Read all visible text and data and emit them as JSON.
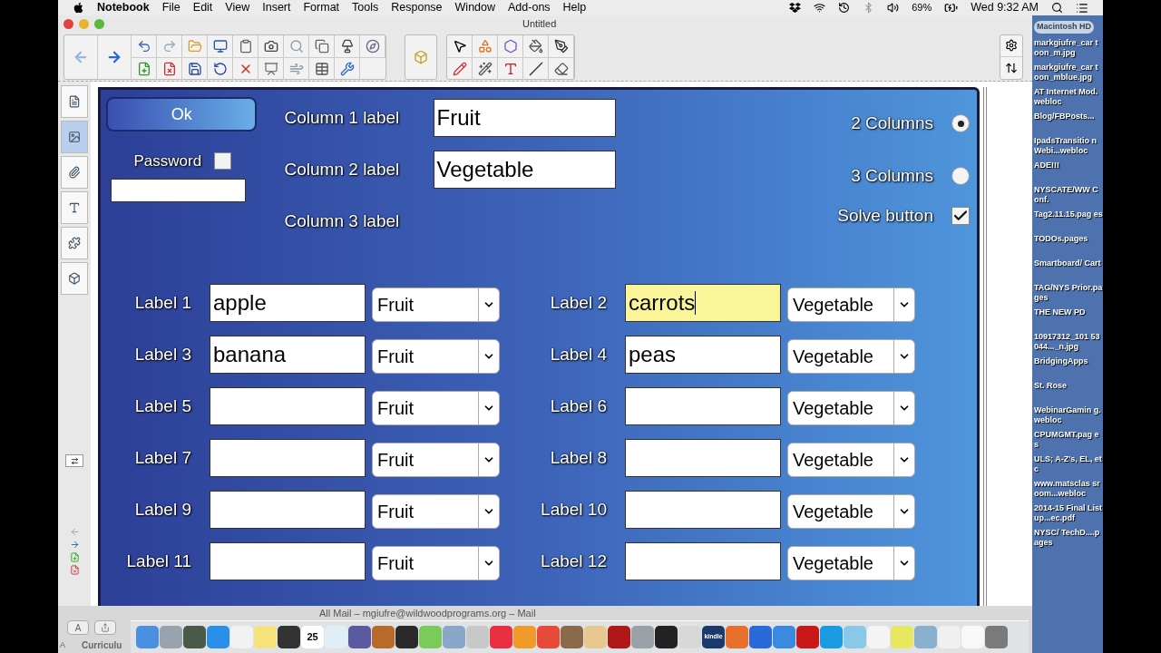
{
  "menu_bar": {
    "app": "Notebook",
    "items": [
      "File",
      "Edit",
      "View",
      "Insert",
      "Format",
      "Tools",
      "Response",
      "Window",
      "Add-ons",
      "Help"
    ],
    "battery": "69%",
    "clock": "Wed 9:32 AM"
  },
  "window": {
    "title": "Untitled"
  },
  "form": {
    "ok_button": "Ok",
    "password": {
      "label": "Password",
      "checked": false
    },
    "column_labels": [
      {
        "label": "Column 1 label",
        "value": "Fruit"
      },
      {
        "label": "Column 2 label",
        "value": "Vegetable"
      },
      {
        "label": "Column 3 label"
      }
    ],
    "column_options": [
      {
        "label": "2 Columns",
        "selected": true
      },
      {
        "label": "3 Columns",
        "selected": false
      }
    ],
    "solve": {
      "label": "Solve button",
      "checked": true
    }
  },
  "rows": [
    {
      "label": "Label 1",
      "value": "apple",
      "category": "Fruit",
      "highlighted": false
    },
    {
      "label": "Label 2",
      "value": "carrots",
      "category": "Vegetable",
      "highlighted": true
    },
    {
      "label": "Label 3",
      "value": "banana",
      "category": "Fruit",
      "highlighted": false
    },
    {
      "label": "Label 4",
      "value": "peas",
      "category": "Vegetable",
      "highlighted": false
    },
    {
      "label": "Label 5",
      "category": "Fruit",
      "highlighted": false
    },
    {
      "label": "Label 6",
      "category": "Vegetable",
      "highlighted": false
    },
    {
      "label": "Label 7",
      "category": "Fruit",
      "highlighted": false
    },
    {
      "label": "Label 8",
      "category": "Vegetable",
      "highlighted": false
    },
    {
      "label": "Label 9",
      "category": "Fruit",
      "highlighted": false
    },
    {
      "label": "Label 10",
      "category": "Vegetable",
      "highlighted": false
    },
    {
      "label": "Label 11",
      "category": "Fruit",
      "highlighted": false
    },
    {
      "label": "Label 12",
      "category": "Vegetable",
      "highlighted": false
    }
  ],
  "desktop": {
    "drive": "Macintosh HD",
    "items": [
      "markgiufre_car toon_m.jpg",
      "markgiufre_car toon_mblue.jpg",
      "AT Internet Mod.webloc",
      "Blog/FBPosts...",
      "IpadsTransitio nWebi...webloc",
      "ADE!!!",
      "NYSCATE/WW Conf.",
      "Tag2.11.15.pag es",
      "TODOs.pages",
      "Smartboard/ Cart",
      "TAG/NYS Prior.pages",
      "THE NEW PD",
      "10917312_101 53044..._n.jpg",
      "BridgingApps",
      "St. Rose",
      "WebinarGamin g.webloc",
      "CPUMGMT.pag es",
      "ULS; A-Z's, EL, etc",
      "www.matsclas sroom...webloc",
      "2014-15 Final Listup...ec.pdf",
      "NYSC/ TechD....pages"
    ]
  },
  "mail_window": {
    "title": "All Mail – mgiufre@wildwoodprograms.org – Mail",
    "font_button": "A",
    "format_menu": "A",
    "mailbox": "Curriculu"
  },
  "dock": [
    {
      "color": "#4a8fe0"
    },
    {
      "color": "#9aa3ad"
    },
    {
      "color": "#4a5a48"
    },
    {
      "color": "#2a8fe8"
    },
    {
      "color": "#f2f2f2"
    },
    {
      "color": "#f5e27a"
    },
    {
      "color": "#333333"
    },
    {
      "color": "#ffffff",
      "text": "25"
    },
    {
      "color": "#e0eef8"
    },
    {
      "color": "#5a5aa0"
    },
    {
      "color": "#b86a2a"
    },
    {
      "color": "#2a2a2a"
    },
    {
      "color": "#7acb5a"
    },
    {
      "color": "#8aa6c8"
    },
    {
      "color": "#c8c8c8"
    },
    {
      "color": "#e83040"
    },
    {
      "color": "#f09a2a"
    },
    {
      "color": "#e84a3a"
    },
    {
      "color": "#8a6a4a"
    },
    {
      "color": "#e8c890"
    },
    {
      "color": "#b01818"
    },
    {
      "color": "#9aa0a8"
    },
    {
      "color": "#222222"
    },
    {
      "color": "#d8d8d8"
    },
    {
      "color": "#1a3a6a",
      "text": "kindle"
    },
    {
      "color": "#e8702a"
    },
    {
      "color": "#2a6ad8"
    },
    {
      "color": "#3a8ae0"
    },
    {
      "color": "#c81818"
    },
    {
      "color": "#1a9ae0"
    },
    {
      "color": "#8ac8e8"
    },
    {
      "color": "#f4f4f4"
    },
    {
      "color": "#e8e860"
    },
    {
      "color": "#8ab0d0"
    },
    {
      "color": "#f0f0f0"
    },
    {
      "color": "#f8f8f8"
    },
    {
      "color": "#7a7a7a"
    }
  ]
}
